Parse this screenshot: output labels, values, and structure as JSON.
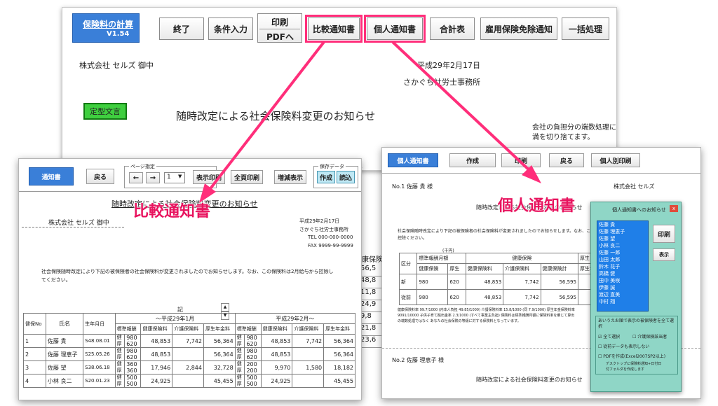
{
  "toolbar": {
    "app_title": "保険料の計算",
    "version": "V1.54",
    "end": "終了",
    "condition": "条件入力",
    "print": "印刷",
    "pdf": "PDFへ",
    "compare": "比較通知書",
    "individual": "個人通知書",
    "total": "合計表",
    "exempt": "雇用保険免除通知",
    "batch": "一括処理"
  },
  "main": {
    "company": "株式会社 セルズ 御中",
    "date": "平成29年2月17日",
    "office": "さかぐち社労士事務所",
    "template_btn": "定型文言",
    "notice_title": "随時改定による社会保険料変更のお知らせ",
    "note1": "会社の負担分の端数処理に",
    "note2": "満を切り捨てます。",
    "partial_na": "な",
    "partial_col": "康保険",
    "partial_vals": [
      "56,5",
      "48,8",
      "11,8",
      "24,9",
      "9,8",
      "21,8",
      "23,6"
    ]
  },
  "compare_panel": {
    "notice_btn": "通知書",
    "back": "戻る",
    "page_group": "ページ指定",
    "prev": "←",
    "next": "→",
    "page_value": "1",
    "print_view": "表示印刷",
    "print_all": "全頁印刷",
    "zoom": "増減表示",
    "save_group": "保存データ",
    "create": "作成",
    "read": "読込",
    "title": "随時改定による社会保険料変更のお知らせ",
    "company": "株式会社 セルズ 御中",
    "date": "平成29年2月17日",
    "office": "さかぐち社労士事務所",
    "tel": "TEL 000-000-0000",
    "fax": "FAX 9999-99-9999",
    "body1": "社会保険随時改定により下記の被保険者の社会保険料が変更されましたのでお知らせします。なお、この保険料は2月給与から控除し",
    "body2": "てください。",
    "ki": "記",
    "headers": {
      "no": "健保No",
      "name": "氏名",
      "dob": "生年月日",
      "before": "～平成29年1月",
      "after": "平成29年2月～",
      "std": "標準報酬",
      "health": "健康保険料",
      "care": "介護保険料",
      "pension": "厚生年金料"
    },
    "rows": [
      {
        "no": "1",
        "name": "佐藤 貴",
        "dob": "S48.08.01",
        "k1": "健",
        "k2": "厚",
        "s1": "980",
        "s2": "620",
        "h": "48,853",
        "c": "7,742",
        "p": "56,364",
        "ns1": "980",
        "ns2": "620",
        "nh": "48,853",
        "nc": "7,742",
        "np": "56,364"
      },
      {
        "no": "2",
        "name": "佐藤 理恵子",
        "dob": "S25.05.26",
        "k1": "健",
        "k2": "厚",
        "s1": "980",
        "s2": "620",
        "h": "48,853",
        "c": "",
        "p": "56,364",
        "ns1": "980",
        "ns2": "620",
        "nh": "48,853",
        "nc": "",
        "np": "56,364"
      },
      {
        "no": "3",
        "name": "佐藤 望",
        "dob": "S38.06.18",
        "k1": "健",
        "k2": "厚",
        "s1": "360",
        "s2": "360",
        "h": "17,946",
        "c": "2,844",
        "p": "32,728",
        "ns1": "200",
        "ns2": "200",
        "nh": "9,970",
        "nc": "1,580",
        "np": "18,182"
      },
      {
        "no": "4",
        "name": "小林 良二",
        "dob": "S20.01.23",
        "k1": "健",
        "k2": "厚",
        "s1": "500",
        "s2": "500",
        "h": "24,925",
        "c": "",
        "p": "45,455",
        "ns1": "500",
        "ns2": "500",
        "nh": "24,925",
        "nc": "",
        "np": "45,455"
      }
    ],
    "callout": "比較通知書"
  },
  "individual_panel": {
    "notice_btn": "個人通知書",
    "create": "作成",
    "print": "印刷",
    "back": "戻る",
    "print_btn": "個人別印刷",
    "recipient": "No.1 佐藤 貴 様",
    "company": "株式会社 セルズ",
    "title": "随時改定による社会保険料変更のお知らせ",
    "body1": "社会保険随時改定により下記の被保険者の社会保険料が変更されましたのでお知らせします。なお、この保険料は2月給与から",
    "body2": "控除ください。",
    "unit": "(千円)",
    "col_div": "区分",
    "col_std": "標準報酬月額",
    "col_health": "健康保険",
    "col_pension": "厚生",
    "col_h": "健康保険料",
    "col_c": "介護保険料",
    "col_t": "健康保険計",
    "col_p": "厚生年金",
    "row_new": {
      "label": "新",
      "a": "980",
      "b": "620",
      "h": "48,853",
      "c": "7,742",
      "t": "56,595"
    },
    "row_old": {
      "label": "従前",
      "a": "980",
      "b": "620",
      "h": "48,853",
      "c": "7,742",
      "t": "56,595"
    },
    "rate_note1": "健康保険料率 99.7/1000 (内本人負担 49.85/1000) 介護保険料率 15.8/1000 (同 7.9/1000) 厚生年金保険料率",
    "rate_note2": "9091/10000 子供子育て拠出金率 2.3/1000 (すべて事業主負担) 保険料は標準報酬月額に保険料率を乗じて算出",
    "rate_note3": "の端数処理ではなく あなたの社会保険の等級に対する保険料となっています。",
    "recipient2": "No.2 佐藤 理恵子 様",
    "title2": "随時改定による社会保険料変更のお知らせ",
    "callout": "個人通知書"
  },
  "dialog": {
    "title": "個人通知書へのお知らせ",
    "close": "x",
    "print": "印刷",
    "view": "表示",
    "list": [
      "佐藤 貴",
      "佐藤 理恵子",
      "佐藤 望",
      "小林 良二",
      "佐藤 一郎",
      "山田 太郎",
      "鈴木 花子",
      "高橋 健",
      "田中 美咲",
      "伊藤 誠",
      "渡辺 直美",
      "中村 翔"
    ],
    "option_label": "あいうえお順で表示の被保険者を全て選択",
    "opt_all": "全て選択",
    "opt_care": "介護保険該当者",
    "opt_history": "従前データも表示しない",
    "opt_pdf": "PDFを作成(Excel2007SP2以上)",
    "footer1": "デスクトップに保険料通知+日付日",
    "footer2": "付フォルダを作成します"
  },
  "colors": {
    "accent_blue": "#3a7fd8",
    "highlight_pink": "#ff2e7a",
    "callout_pink": "#e8145f",
    "template_green": "#3fcf3f",
    "dialog_teal": "#8fd6c6",
    "list_blue": "#1f7fe8"
  }
}
